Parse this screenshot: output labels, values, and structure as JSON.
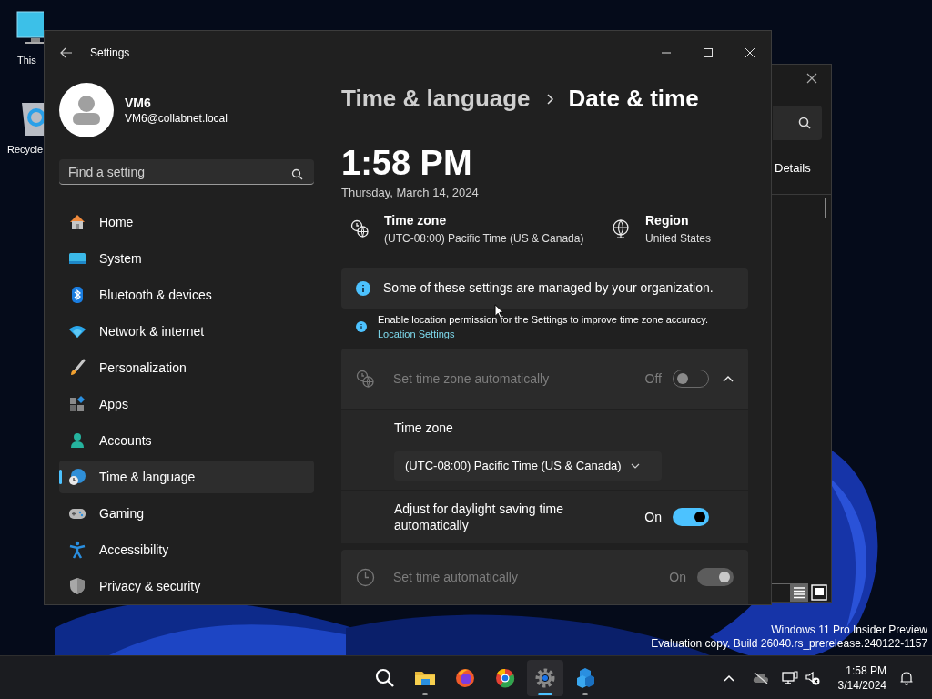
{
  "desktop_icons": [
    {
      "label": "This"
    },
    {
      "label": "Recycle"
    }
  ],
  "background_window": {
    "tab": "Details"
  },
  "settings": {
    "title": "Settings",
    "account": {
      "name": "VM6",
      "email": "VM6@collabnet.local"
    },
    "search": {
      "placeholder": "Find a setting"
    },
    "nav": [
      {
        "label": "Home",
        "selected": false
      },
      {
        "label": "System",
        "selected": false
      },
      {
        "label": "Bluetooth & devices",
        "selected": false
      },
      {
        "label": "Network & internet",
        "selected": false
      },
      {
        "label": "Personalization",
        "selected": false
      },
      {
        "label": "Apps",
        "selected": false
      },
      {
        "label": "Accounts",
        "selected": false
      },
      {
        "label": "Time & language",
        "selected": true
      },
      {
        "label": "Gaming",
        "selected": false
      },
      {
        "label": "Accessibility",
        "selected": false
      },
      {
        "label": "Privacy & security",
        "selected": false
      }
    ],
    "breadcrumb": [
      "Time & language",
      "Date & time"
    ],
    "time": "1:58 PM",
    "date": "Thursday, March 14, 2024",
    "summary": [
      {
        "title": "Time zone",
        "value": "(UTC-08:00) Pacific Time (US & Canada)"
      },
      {
        "title": "Region",
        "value": "United States"
      }
    ],
    "notice": "Some of these settings are managed by your organization.",
    "location_notice": {
      "text": "Enable location permission for the Settings to improve time zone accuracy.",
      "link": "Location Settings"
    },
    "rows": [
      {
        "kind": "expander",
        "label": "Set time zone automatically",
        "state": "Off",
        "on": false,
        "disabled": true,
        "expanded": true
      },
      {
        "kind": "dropdown",
        "label": "Time zone",
        "value": "(UTC-08:00) Pacific Time (US & Canada)"
      },
      {
        "kind": "toggle",
        "label": "Adjust for daylight saving time automatically",
        "state": "On",
        "on": true,
        "disabled": false
      },
      {
        "kind": "card",
        "label": "Set time automatically",
        "state": "On",
        "on": true,
        "disabled": true
      }
    ]
  },
  "watermark": [
    "Windows 11 Pro Insider Preview",
    "Evaluation copy. Build 26040.rs_prerelease.240122-1157"
  ],
  "taskbar": {
    "apps": [
      {
        "running": false,
        "active": false
      },
      {
        "running": true,
        "active": false
      },
      {
        "running": false,
        "active": false
      },
      {
        "running": false,
        "active": false
      },
      {
        "running": true,
        "active": true
      },
      {
        "running": true,
        "active": false
      }
    ],
    "time": "1:58 PM",
    "date": "3/14/2024"
  }
}
